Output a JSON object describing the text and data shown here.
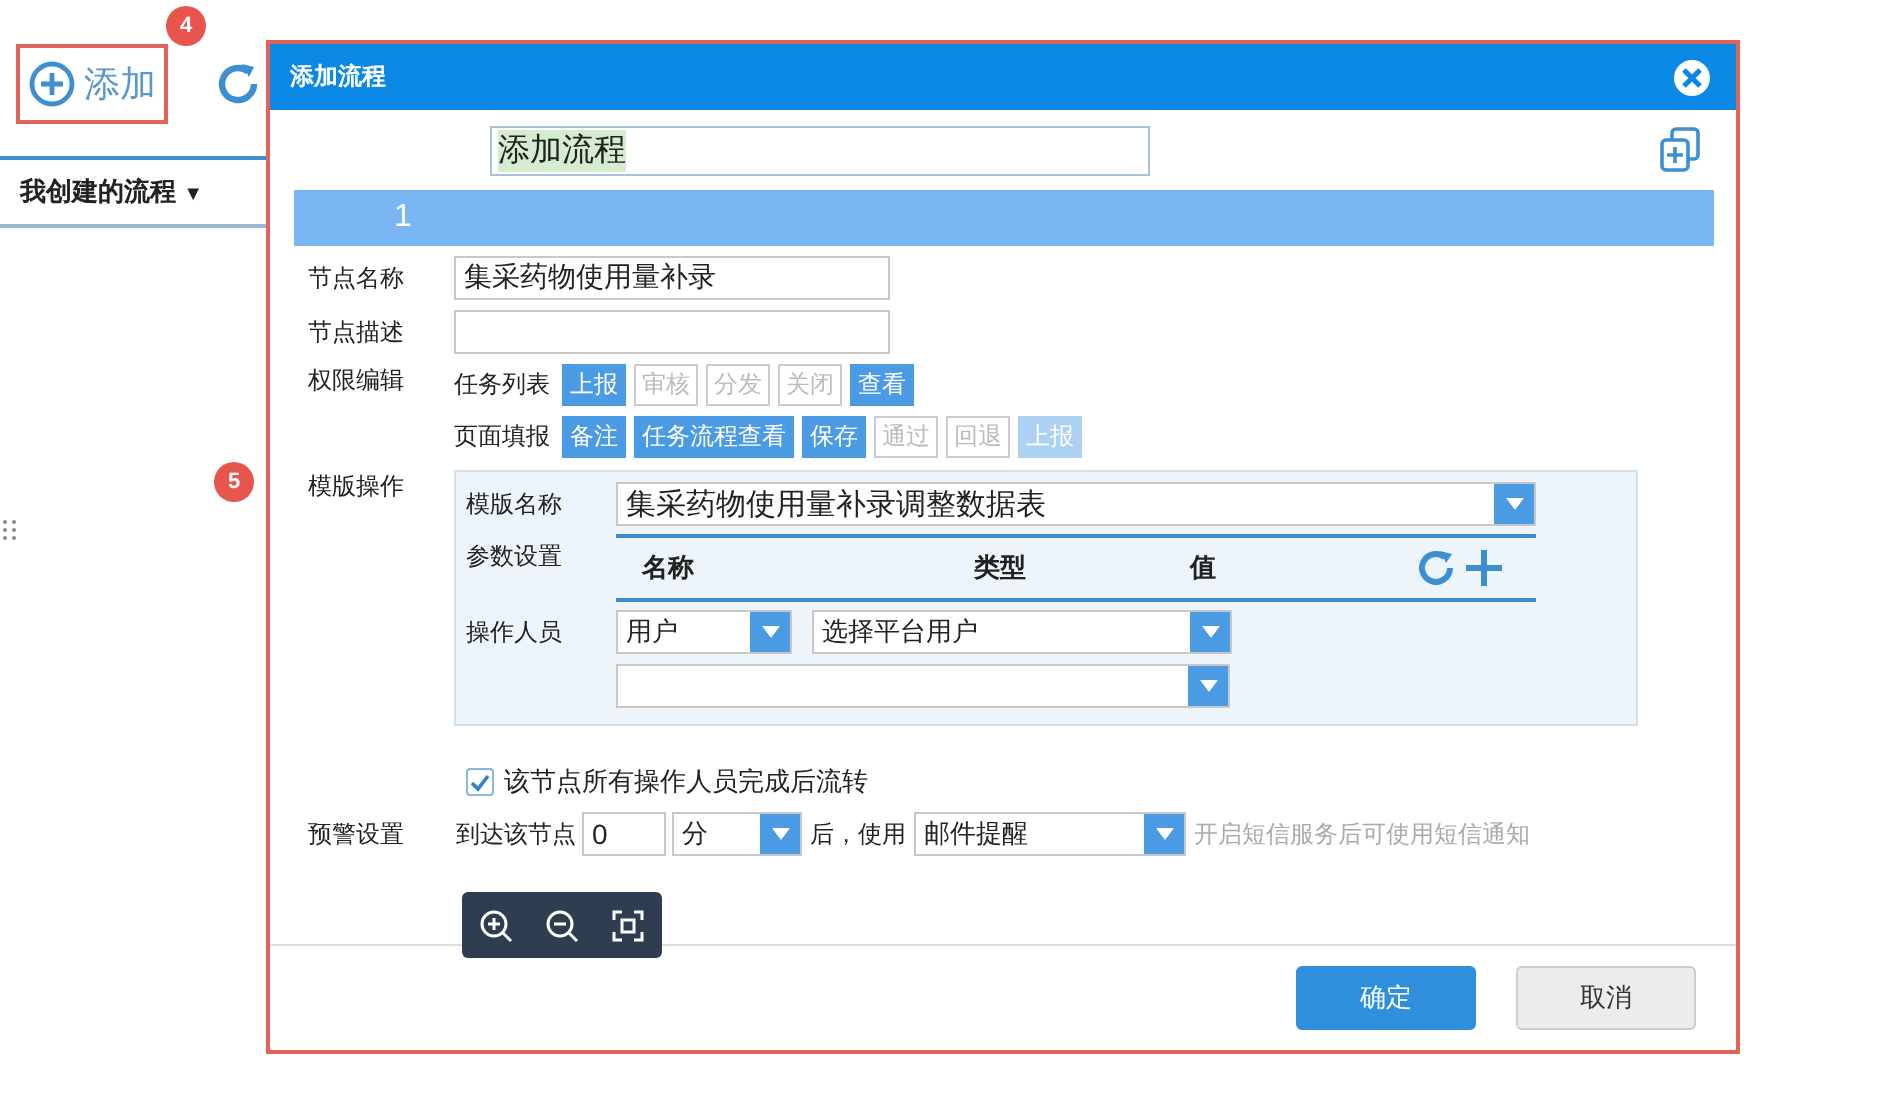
{
  "toolbar": {
    "add_button": "添加"
  },
  "annotations": [
    {
      "label": "4"
    },
    {
      "label": "5"
    }
  ],
  "list_tab": {
    "label": "我创建的流程",
    "caret": "▼"
  },
  "dialog": {
    "title": "添加流程",
    "flow_name": "添加流程",
    "step": "1",
    "node_name": {
      "label": "节点名称",
      "value": "集采药物使用量补录"
    },
    "node_desc": {
      "label": "节点描述"
    },
    "permissions": {
      "label": "权限编辑",
      "groups": [
        {
          "label": "任务列表",
          "tags": [
            {
              "label": "上报",
              "on": true,
              "disabled": false
            },
            {
              "label": "审核",
              "on": false,
              "disabled": false
            },
            {
              "label": "分发",
              "on": false,
              "disabled": false
            },
            {
              "label": "关闭",
              "on": false,
              "disabled": false
            },
            {
              "label": "查看",
              "on": true,
              "disabled": false
            }
          ]
        },
        {
          "label": "页面填报",
          "tags": [
            {
              "label": "备注",
              "on": true,
              "disabled": false
            },
            {
              "label": "任务流程查看",
              "on": true,
              "disabled": false
            },
            {
              "label": "保存",
              "on": true,
              "disabled": false
            },
            {
              "label": "通过",
              "on": false,
              "disabled": false
            },
            {
              "label": "回退",
              "on": false,
              "disabled": false
            },
            {
              "label": "上报",
              "on": true,
              "disabled": true
            }
          ]
        }
      ]
    },
    "template": {
      "label": "模版操作",
      "name_label": "模版名称",
      "name_value": "集采药物使用量补录调整数据表",
      "params_label": "参数设置",
      "columns": [
        "名称",
        "类型",
        "值"
      ],
      "operators_label": "操作人员",
      "operator_type": "用户",
      "operator_user": "选择平台用户"
    },
    "flow_option": {
      "label": "该节点所有操作人员完成后流转",
      "checked": true
    },
    "warning": {
      "label": "预警设置",
      "prefix": "到达该节点",
      "amount": "0",
      "unit": "分",
      "middle": "后，使用",
      "method": "邮件提醒",
      "hint": "开启短信服务后可使用短信通知"
    },
    "buttons": {
      "ok": "确定",
      "cancel": "取消"
    }
  }
}
